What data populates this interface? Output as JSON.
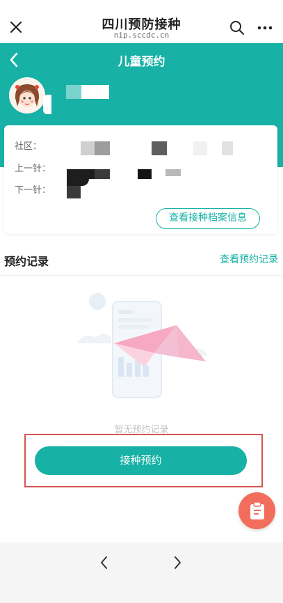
{
  "browser": {
    "title": "四川预防接种",
    "url": "nip.sccdc.cn"
  },
  "header": {
    "title": "儿童预约"
  },
  "card": {
    "community_label": "社区：",
    "last_dose_label": "上一针：",
    "next_dose_label": "下一针：",
    "archive_button": "查看接种档案信息"
  },
  "records": {
    "title": "预约记录",
    "link": "查看预约记录",
    "empty_text": "暂无预约记录"
  },
  "actions": {
    "vaccinate_button": "接种预约"
  },
  "colors": {
    "accent": "#17b1a5",
    "fab": "#f26d5b",
    "highlight": "#d9534f"
  }
}
